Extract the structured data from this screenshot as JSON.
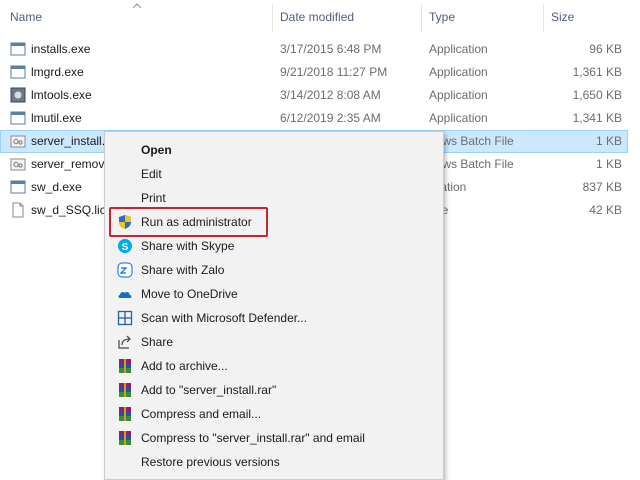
{
  "header": {
    "name": "Name",
    "date_modified": "Date modified",
    "type": "Type",
    "size": "Size"
  },
  "files": [
    {
      "name": "installs.exe",
      "date": "3/17/2015 6:48 PM",
      "type": "Application",
      "size": "96 KB",
      "icon": "application-icon"
    },
    {
      "name": "lmgrd.exe",
      "date": "9/21/2018 11:27 PM",
      "type": "Application",
      "size": "1,361 KB",
      "icon": "application-icon"
    },
    {
      "name": "lmtools.exe",
      "date": "3/14/2012 8:08 AM",
      "type": "Application",
      "size": "1,650 KB",
      "icon": "tools-app-icon"
    },
    {
      "name": "lmutil.exe",
      "date": "6/12/2019 2:35 AM",
      "type": "Application",
      "size": "1,341 KB",
      "icon": "application-icon"
    },
    {
      "name": "server_install.",
      "date": "",
      "type": "dows Batch File",
      "size": "1 KB",
      "icon": "batch-file-icon"
    },
    {
      "name": "server_remov",
      "date": "",
      "type": "dows Batch File",
      "size": "1 KB",
      "icon": "batch-file-icon"
    },
    {
      "name": "sw_d.exe",
      "date": "",
      "type": "lication",
      "size": "837 KB",
      "icon": "application-icon"
    },
    {
      "name": "sw_d_SSQ.lic",
      "date": "",
      "type": "File",
      "size": "42 KB",
      "icon": "document-icon"
    }
  ],
  "context_menu": {
    "items": [
      {
        "label": "Open",
        "icon": "",
        "bold": true
      },
      {
        "label": "Edit",
        "icon": ""
      },
      {
        "label": "Print",
        "icon": ""
      },
      {
        "label": "Run as administrator",
        "icon": "uac-shield-icon"
      },
      {
        "label": "Share with Skype",
        "icon": "skype-icon"
      },
      {
        "label": "Share with Zalo",
        "icon": "zalo-icon"
      },
      {
        "label": "Move to OneDrive",
        "icon": "onedrive-icon"
      },
      {
        "label": "Scan with Microsoft Defender...",
        "icon": "defender-icon"
      },
      {
        "label": "Share",
        "icon": "share-icon"
      },
      {
        "label": "Add to archive...",
        "icon": "winrar-icon"
      },
      {
        "label": "Add to \"server_install.rar\"",
        "icon": "winrar-icon"
      },
      {
        "label": "Compress and email...",
        "icon": "winrar-icon"
      },
      {
        "label": "Compress to \"server_install.rar\" and email",
        "icon": "winrar-icon"
      },
      {
        "label": "Restore previous versions",
        "icon": ""
      }
    ]
  },
  "colors": {
    "selection_bg": "#cce8ff",
    "selection_border": "#99d1ff",
    "highlight_border": "#c4262e",
    "menu_bg": "#f2f2f2",
    "header_text": "#4d6082"
  }
}
